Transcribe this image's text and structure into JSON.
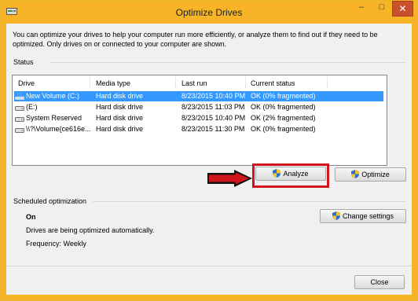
{
  "window": {
    "title": "Optimize Drives"
  },
  "description": "You can optimize your drives to help your computer run more efficiently, or analyze them to find out if they need to be optimized. Only drives on or connected to your computer are shown.",
  "status": {
    "label": "Status",
    "columns": [
      "Drive",
      "Media type",
      "Last run",
      "Current status"
    ],
    "drives": [
      {
        "drive": "New Volume (C:)",
        "media_type": "Hard disk drive",
        "last_run": "8/23/2015 10:40 PM",
        "current_status": "OK (0% fragmented)",
        "selected": true,
        "icon": "windows-drive-icon"
      },
      {
        "drive": "(E:)",
        "media_type": "Hard disk drive",
        "last_run": "8/23/2015 11:03 PM",
        "current_status": "OK (0% fragmented)",
        "selected": false,
        "icon": "drive-icon"
      },
      {
        "drive": "System Reserved",
        "media_type": "Hard disk drive",
        "last_run": "8/23/2015 10:40 PM",
        "current_status": "OK (2% fragmented)",
        "selected": false,
        "icon": "drive-icon"
      },
      {
        "drive": "\\\\?\\Volume{ce616e...",
        "media_type": "Hard disk drive",
        "last_run": "8/23/2015 11:30 PM",
        "current_status": "OK (0% fragmented)",
        "selected": false,
        "icon": "drive-icon"
      }
    ]
  },
  "actions": {
    "analyze": "Analyze",
    "optimize": "Optimize"
  },
  "scheduled": {
    "label": "Scheduled optimization",
    "state": "On",
    "text": "Drives are being optimized automatically.",
    "frequency": "Frequency: Weekly",
    "change_settings": "Change settings"
  },
  "footer": {
    "close": "Close"
  },
  "colors": {
    "title_bar": "#f6b426",
    "selection": "#3399ff",
    "highlight": "#d0161c",
    "arrow": "#d0161c"
  }
}
